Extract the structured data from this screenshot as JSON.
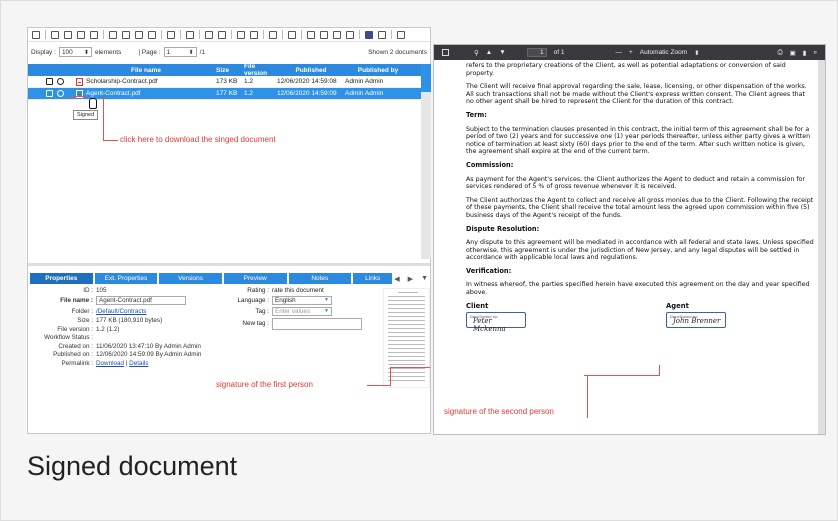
{
  "displaybar": {
    "display_label": "Display :",
    "display_value": "100",
    "elements_label": "elements",
    "page_label": "| Page :",
    "page_value": "1",
    "page_total": "/1",
    "shown": "Shown 2 documents"
  },
  "grid": {
    "headers": [
      "File name",
      "Size",
      "File version",
      "Published",
      "Published by"
    ],
    "rows": [
      {
        "name": "Scholarship-Contract.pdf",
        "size": "173 KB",
        "version": "1.2",
        "published": "12/06/2020 14:59:08",
        "by": "Admin Admin"
      },
      {
        "name": "Agent-Contract.pdf",
        "size": "177 KB",
        "version": "1.2",
        "published": "12/06/2020 14:59:09",
        "by": "Admin Admin"
      }
    ]
  },
  "tooltip": "Signed",
  "annotations": {
    "download": "click here to download the singed document",
    "sig1": "signature of the first person",
    "sig2": "signature of the second person"
  },
  "tabs": [
    "Properties",
    "Ext. Properties",
    "Versions",
    "Preview",
    "Notes",
    "Links"
  ],
  "properties": {
    "id_label": "ID :",
    "id": "105",
    "file_name_label": "File name :",
    "file_name": "Agent-Contract.pdf",
    "folder_label": "Folder :",
    "folder": "/Default/Contracts",
    "size_label": "Size :",
    "size": "177 KB (180,910 bytes)",
    "version_label": "File version :",
    "version": "1.2 (1.2)",
    "workflow_label": "Workflow Status :",
    "workflow": "",
    "created_label": "Created on :",
    "created": "11/06/2020 13:47:10 By Admin Admin",
    "published_label": "Published on :",
    "published": "12/06/2020 14:59:09 By Admin Admin",
    "permalink_label": "Permalink :",
    "download": "Download",
    "details": "Details",
    "rating_label": "Rating :",
    "rating": "rate this document",
    "language_label": "Language :",
    "language": "English",
    "tag_label": "Tag :",
    "tag_placeholder": "Enter values",
    "newtag_label": "New tag :"
  },
  "pdf": {
    "page_input": "1",
    "page_of": "of 1",
    "zoom": "Automatic Zoom",
    "p1": "refers to the proprietary creations of the Client, as well as potential adaptations or conversion of said property.",
    "p2": "The Client will receive final approval regarding the sale, lease, licensing, or other dispensation of the works. All such transactions shall not be made without the Client's express written consent. The Client agrees that no other agent shall be hired to represent the Client for the duration of this contract.",
    "h_term": "Term:",
    "p3": "Subject to the termination clauses presented in this contract, the initial term of this agreement shall be for a period of two (2) years and for successive one (1) year periods thereafter, unless either party gives a written notice of termination at least sixty (60) days prior to the end of the term. After such written notice is given, the agreement shall expire at the end of the current term.",
    "h_comm": "Commission:",
    "p4": "As payment for the Agent's services, the Client authorizes the Agent to deduct and retain a commission for services rendered of 5 % of gross revenue whenever it is received.",
    "p5": "The Client authorizes the Agent to collect and receive all gross monies due to the Client. Following the receipt of these payments, the Client shall receive the total amount less the agreed upon commission within five (5) business days of the Agent's receipt of the funds.",
    "h_disp": "Dispute Resolution:",
    "p6": "Any dispute to this agreement will be mediated in accordance with all federal and state laws. Unless specified otherwise, this agreement is under the jurisdiction of New Jersey, and any legal disputes will be settled in accordance with applicable local laws and regulations.",
    "h_ver": "Verification:",
    "p7": "In witness whereof, the parties specified herein have executed this agreement on the day and year specified above.",
    "client": "Client",
    "agent": "Agent",
    "docusigned": "DocuSigned by:",
    "sig_client": "Peter Mckenna",
    "sig_agent": "John Brenner"
  },
  "caption": "Signed document"
}
